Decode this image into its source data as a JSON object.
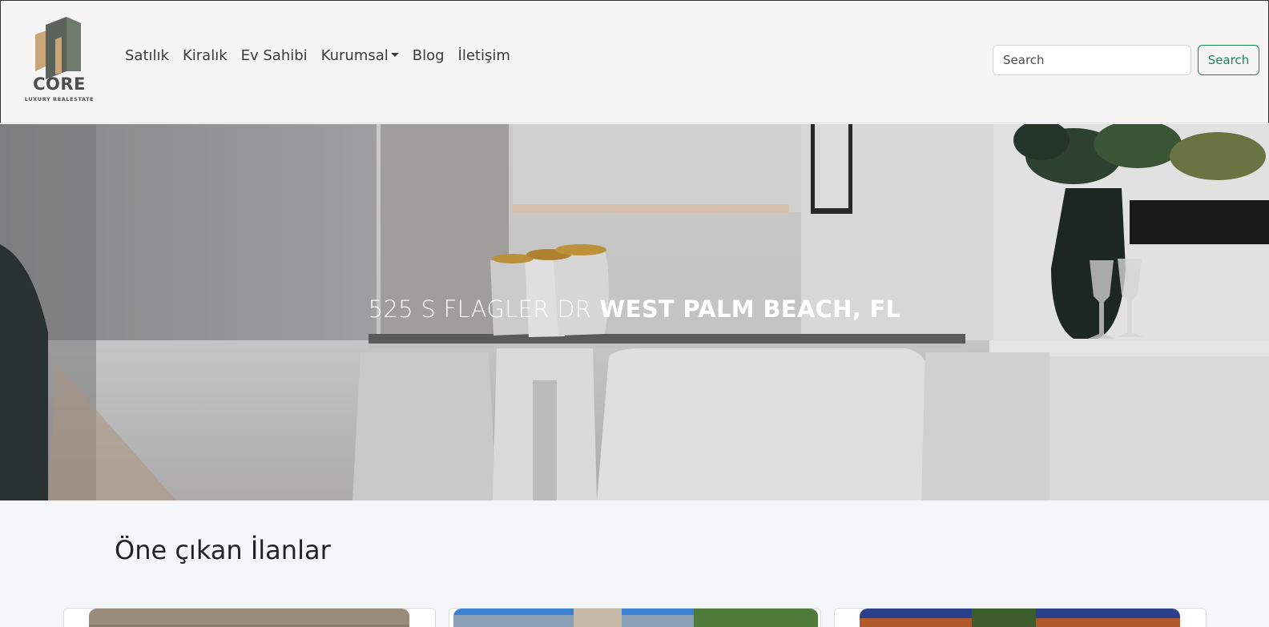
{
  "brand": {
    "name": "CORE",
    "tagline": "LUXURY REALESTATE"
  },
  "nav": {
    "items": [
      "Satılık",
      "Kiralık",
      "Ev Sahibi",
      "Kurumsal",
      "Blog",
      "İletişim"
    ]
  },
  "search": {
    "placeholder": "Search",
    "button_label": "Search"
  },
  "hero": {
    "address": "525 S FLAGLER DR",
    "city": "WEST PALM BEACH, FL"
  },
  "featured": {
    "title": "Öne çıkan İlanlar"
  },
  "colors": {
    "accent": "#198754",
    "logo_dark": "#5a625a",
    "logo_tan": "#c9a57a"
  }
}
